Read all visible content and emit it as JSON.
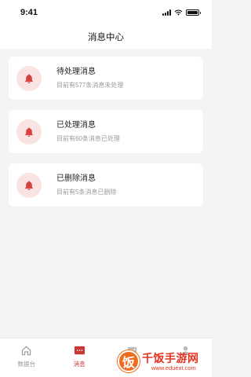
{
  "status_bar": {
    "time": "9:41"
  },
  "nav": {
    "title": "消息中心"
  },
  "messages": [
    {
      "title": "待处理消息",
      "subtitle": "目前有577条消息未处理",
      "icon": "bell-icon"
    },
    {
      "title": "已处理消息",
      "subtitle": "目前有60条消息已处理",
      "icon": "bell-icon"
    },
    {
      "title": "已删除消息",
      "subtitle": "目前有5条消息已删除",
      "icon": "bell-icon"
    }
  ],
  "tabs": [
    {
      "label": "数据台",
      "icon": "home-icon",
      "active": false
    },
    {
      "label": "消息",
      "icon": "message-icon",
      "active": true
    },
    {
      "label": "",
      "icon": "chart-icon",
      "active": false
    },
    {
      "label": "",
      "icon": "user-icon",
      "active": false
    }
  ],
  "watermark": {
    "badge": "饭",
    "name": "千饭手游网",
    "url": "www.eduext.com"
  },
  "colors": {
    "accent": "#c93636",
    "bell_bg": "#f9e3e3",
    "page_bg": "#f4f4f6"
  }
}
